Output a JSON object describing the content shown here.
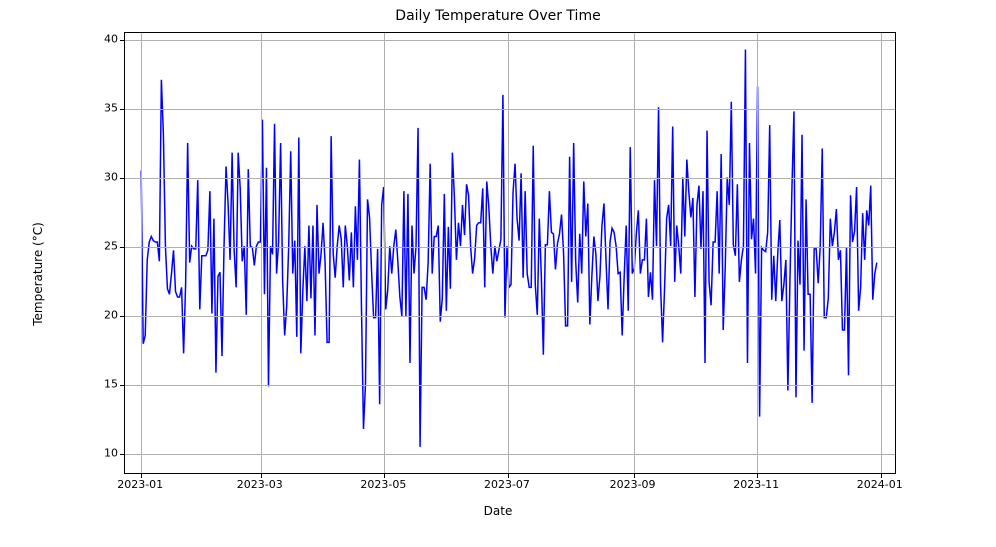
{
  "chart_data": {
    "type": "line",
    "title": "Daily Temperature Over Time",
    "xlabel": "Date",
    "ylabel": "Temperature (°C)",
    "line_color": "#0000ff",
    "grid": true,
    "x_start": "2023-01-01",
    "x_end": "2024-01-01",
    "x_ticks": [
      "2023-01",
      "2023-03",
      "2023-05",
      "2023-07",
      "2023-09",
      "2023-11",
      "2024-01"
    ],
    "y_ticks": [
      10,
      15,
      20,
      25,
      30,
      35,
      40
    ],
    "ylim": [
      8.5,
      40.5
    ],
    "xlim_days": [
      -8,
      373
    ],
    "series": [
      {
        "name": "Temperature",
        "x_day_index": "0..364 consecutive",
        "values": [
          30.5,
          17.9,
          18.5,
          24.0,
          25.3,
          25.7,
          25.4,
          25.3,
          25.3,
          23.9,
          37.1,
          33.1,
          25.0,
          21.9,
          21.5,
          23.0,
          24.7,
          21.7,
          21.3,
          21.3,
          22.0,
          17.2,
          22.3,
          32.5,
          23.8,
          25.0,
          24.8,
          24.8,
          29.8,
          20.4,
          24.3,
          24.3,
          24.3,
          24.7,
          29.0,
          20.1,
          27.0,
          15.8,
          22.8,
          23.1,
          17.0,
          25.0,
          30.8,
          28.1,
          24.0,
          31.8,
          24.7,
          22.0,
          31.8,
          29.2,
          23.9,
          25.0,
          20.0,
          30.6,
          25.0,
          24.9,
          23.6,
          25.0,
          25.3,
          25.3,
          34.2,
          21.5,
          30.7,
          14.8,
          25.0,
          24.4,
          33.9,
          23.0,
          25.3,
          32.5,
          22.5,
          18.5,
          20.6,
          25.0,
          31.9,
          23.0,
          25.4,
          18.4,
          32.9,
          17.2,
          21.8,
          25.0,
          21.0,
          26.5,
          21.2,
          26.5,
          18.5,
          28.0,
          23.0,
          24.4,
          26.7,
          23.8,
          18.0,
          18.0,
          33.0,
          24.5,
          22.7,
          25.0,
          26.5,
          25.5,
          22.0,
          26.5,
          25.0,
          22.5,
          26.0,
          22.0,
          27.9,
          24.0,
          31.3,
          20.6,
          11.7,
          15.0,
          28.4,
          27.1,
          23.2,
          19.8,
          19.8,
          24.8,
          13.5,
          28.0,
          29.3,
          20.4,
          21.8,
          25.0,
          23.0,
          25.0,
          26.2,
          23.9,
          21.3,
          19.9,
          29.0,
          19.9,
          28.8,
          16.5,
          26.5,
          23.0,
          25.0,
          33.6,
          10.4,
          22.0,
          22.0,
          21.1,
          23.8,
          31.0,
          23.0,
          25.7,
          25.7,
          26.5,
          19.5,
          21.2,
          28.8,
          20.3,
          26.4,
          21.9,
          31.8,
          28.5,
          24.0,
          26.7,
          25.0,
          28.0,
          25.8,
          29.5,
          28.7,
          25.0,
          23.0,
          24.1,
          26.5,
          26.7,
          26.7,
          29.2,
          22.0,
          29.7,
          27.9,
          25.0,
          23.0,
          25.0,
          23.9,
          24.7,
          25.5,
          36.0,
          19.8,
          25.0,
          22.0,
          22.2,
          28.9,
          31.0,
          27.0,
          25.4,
          30.3,
          22.7,
          29.0,
          23.0,
          22.0,
          22.0,
          32.3,
          22.2,
          20.0,
          27.0,
          22.8,
          17.1,
          25.1,
          25.1,
          29.0,
          26.0,
          25.9,
          23.3,
          25.2,
          25.9,
          27.3,
          24.5,
          19.2,
          19.2,
          31.5,
          22.4,
          32.5,
          23.9,
          20.9,
          25.9,
          23.0,
          29.7,
          25.7,
          28.1,
          19.3,
          22.8,
          25.7,
          24.4,
          21.0,
          22.8,
          26.5,
          28.1,
          24.0,
          20.4,
          25.3,
          26.3,
          26.0,
          25.0,
          23.0,
          23.1,
          18.5,
          22.8,
          26.5,
          20.3,
          32.2,
          23.0,
          23.4,
          25.9,
          27.6,
          23.0,
          24.0,
          24.0,
          27.0,
          21.3,
          23.1,
          21.1,
          29.8,
          25.0,
          35.1,
          22.1,
          18.0,
          22.0,
          27.0,
          28.0,
          25.0,
          33.7,
          22.4,
          26.5,
          25.0,
          23.0,
          30.0,
          25.7,
          31.3,
          28.9,
          27.1,
          28.5,
          21.3,
          28.0,
          29.4,
          24.8,
          29.0,
          16.5,
          33.4,
          22.4,
          20.7,
          25.3,
          25.3,
          29.0,
          23.0,
          31.7,
          18.9,
          23.5,
          30.0,
          28.0,
          35.5,
          25.1,
          24.3,
          29.5,
          22.4,
          24.0,
          25.0,
          39.3,
          16.5,
          32.5,
          25.5,
          27.0,
          23.0,
          36.6,
          12.6,
          24.9,
          24.7,
          24.6,
          26.0,
          33.8,
          21.1,
          24.3,
          21.0,
          24.5,
          26.9,
          21.0,
          22.2,
          24.0,
          14.5,
          22.4,
          29.2,
          34.8,
          14.0,
          25.4,
          22.2,
          33.1,
          17.4,
          28.4,
          21.5,
          21.5,
          13.6,
          24.8,
          24.8,
          22.3,
          25.0,
          32.1,
          19.8,
          19.8,
          21.2,
          27.0,
          25.0,
          26.0,
          27.7,
          24.0,
          24.7,
          18.9,
          18.9,
          24.9,
          15.6,
          28.7,
          25.3,
          26.1,
          29.3,
          20.3,
          22.0,
          27.4,
          24.0,
          27.6,
          26.5,
          29.4,
          21.1,
          23.0,
          23.8
        ]
      }
    ]
  }
}
